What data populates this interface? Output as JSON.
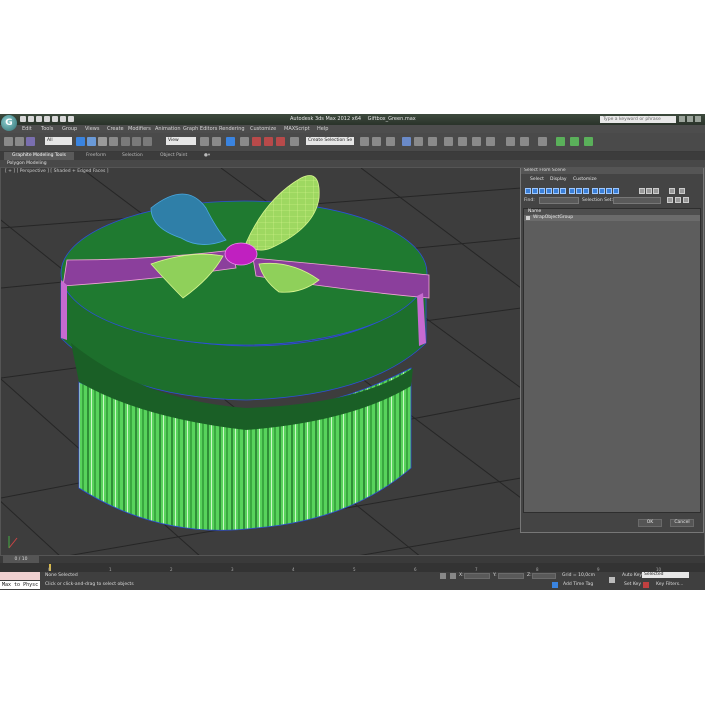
{
  "app": {
    "title": "Autodesk 3ds Max  2012 x64",
    "file": "Giftbox_Green.max",
    "search_placeholder": "Type a keyword or phrase",
    "logo_letter": "G"
  },
  "menu": [
    "Edit",
    "Tools",
    "Group",
    "Views",
    "Create",
    "Modifiers",
    "Animation",
    "Graph Editors",
    "Rendering",
    "Customize",
    "MAXScript",
    "Help"
  ],
  "toolbar": {
    "selection_filter": "All",
    "ref_coord": "View",
    "named_selection": "Create Selection Se"
  },
  "ribbon": {
    "tabs": [
      "Graphite Modeling Tools",
      "Freeform",
      "Selection",
      "Object Paint"
    ],
    "panel": "Polygon Modeling"
  },
  "viewport": {
    "label": "[ + ] [ Perspective ] [ Shaded + Edged Faces ]"
  },
  "dialog": {
    "title": "Select From Scene",
    "menu": [
      "Select",
      "Display",
      "Customize"
    ],
    "find_label": "Find:",
    "selection_set_label": "Selection Set:",
    "column_header": "Name",
    "rows": [
      "WrapObjectGroup"
    ],
    "ok_label": "OK",
    "cancel_label": "Cancel"
  },
  "timeline": {
    "frame": "0 / 10",
    "ticks": [
      "0",
      "1",
      "2",
      "3",
      "4",
      "5",
      "6",
      "7",
      "8",
      "9",
      "10"
    ]
  },
  "status": {
    "maxscript": "Max to Physc",
    "selection": "None Selected",
    "prompt": "Click or click-and-drag to select objects",
    "x_label": "X:",
    "y_label": "Y:",
    "z_label": "Z:",
    "grid": "Grid = 10,0cm",
    "auto_key": "Auto Key",
    "auto_key_value": "Selected",
    "set_key": "Set Key",
    "key_filters": "Key Filters...",
    "add_time_tag": "Add Time Tag"
  },
  "colors": {
    "box_green": "#1e7a2e",
    "stripe_green": "#66e06a",
    "ribbon_pink": "#f3a6d8",
    "bow_yellow": "#b8f07a",
    "bow_blue": "#4aa8e0",
    "knot_magenta": "#c020c0",
    "wire_blue": "#2c4fd8"
  }
}
